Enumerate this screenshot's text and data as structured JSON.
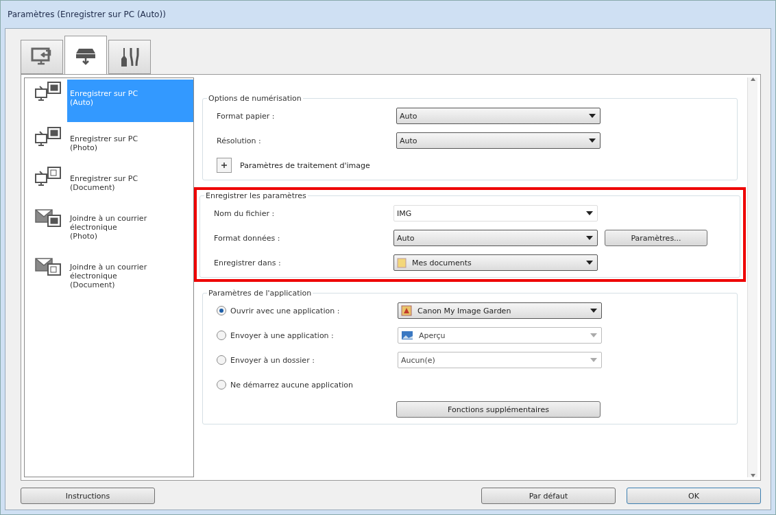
{
  "window": {
    "title": "Paramètres (Enregistrer sur PC (Auto))"
  },
  "tabs": [
    {
      "selected": false
    },
    {
      "selected": true
    },
    {
      "selected": false
    }
  ],
  "sidebar": {
    "items": [
      {
        "lines": [
          "Enregistrer sur PC",
          "(Auto)"
        ],
        "selected": true
      },
      {
        "lines": [
          "Enregistrer sur PC",
          "(Photo)"
        ],
        "selected": false
      },
      {
        "lines": [
          "Enregistrer sur PC",
          "(Document)"
        ],
        "selected": false
      },
      {
        "lines": [
          "Joindre à un courrier",
          "électronique",
          "(Photo)"
        ],
        "selected": false
      },
      {
        "lines": [
          "Joindre à un courrier",
          "électronique",
          "(Document)"
        ],
        "selected": false
      }
    ]
  },
  "groups": [
    {
      "title": "Options de numérisation",
      "highlighted": false,
      "rows": [
        {
          "kind": "select",
          "label": "Format papier :",
          "value": "Auto",
          "disabled": false
        },
        {
          "kind": "select",
          "label": "Résolution :",
          "value": "Auto",
          "disabled": false
        },
        {
          "kind": "expander",
          "label": "Paramètres de traitement d'image",
          "expanded": false
        }
      ]
    },
    {
      "title": "Enregistrer les paramètres",
      "highlighted": true,
      "rows": [
        {
          "kind": "combo",
          "label": "Nom du fichier :",
          "value": "IMG"
        },
        {
          "kind": "select",
          "label": "Format données :",
          "value": "Auto",
          "disabled": false,
          "button": "Paramètres..."
        },
        {
          "kind": "select",
          "label": "Enregistrer dans :",
          "value": "Mes documents",
          "disabled": false
        }
      ]
    },
    {
      "title": "Paramètres de l'application",
      "highlighted": false,
      "rows": [
        {
          "kind": "radio",
          "label": "Ouvrir avec une application :",
          "selected": true,
          "value": "Canon My Image Garden",
          "disabled": false
        },
        {
          "kind": "radio",
          "label": "Envoyer à une application :",
          "selected": false,
          "value": "Aperçu",
          "disabled": true
        },
        {
          "kind": "radio",
          "label": "Envoyer à un dossier :",
          "selected": false,
          "value": "Aucun(e)",
          "disabled": true
        },
        {
          "kind": "radio",
          "label": "Ne démarrez aucune application",
          "selected": false
        },
        {
          "kind": "button",
          "label": "Fonctions supplémentaires"
        }
      ]
    }
  ],
  "footer": {
    "left": "Instructions",
    "buttons": [
      {
        "label": "Par défaut",
        "default": false
      },
      {
        "label": "OK",
        "default": true
      }
    ]
  }
}
